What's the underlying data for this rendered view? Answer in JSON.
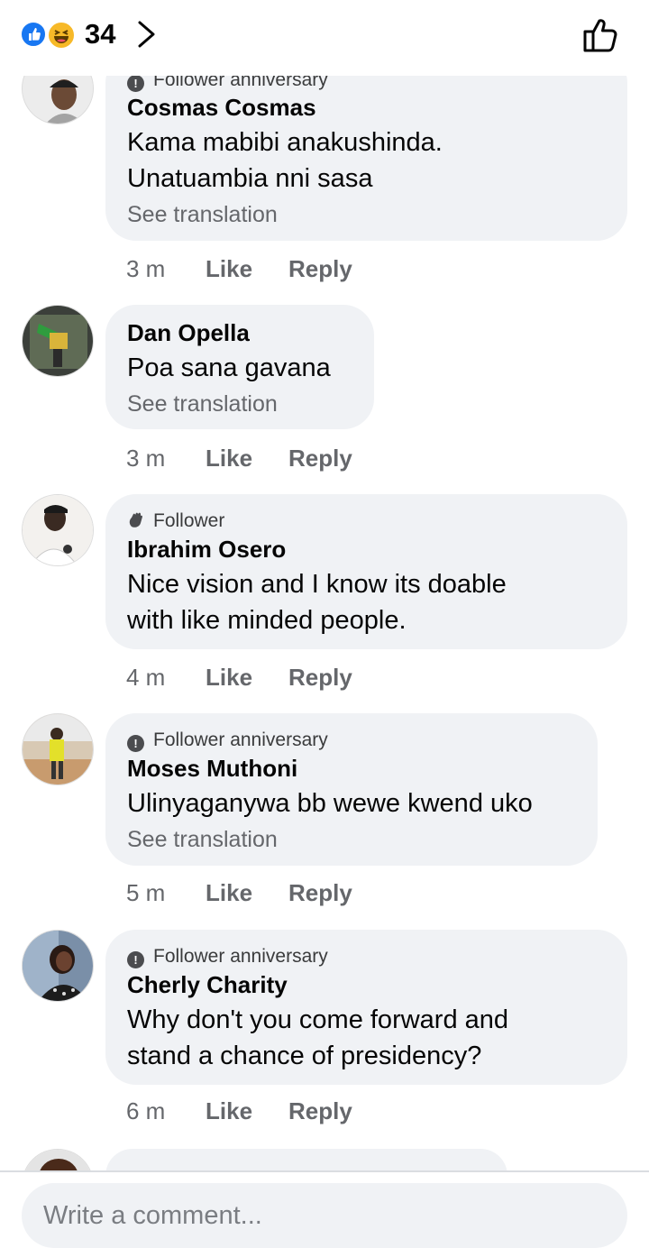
{
  "header": {
    "reaction_count": "34",
    "reaction_icons": [
      "like-reaction-icon",
      "haha-reaction-icon"
    ],
    "like_icon": "thumbs-up-outline-icon"
  },
  "comments": [
    {
      "badge": "Follower anniversary",
      "author": "Cosmas Cosmas",
      "text_lines": [
        "Kama mabibi anakushinda.",
        "Unatuambia nni sasa"
      ],
      "see_translation": "See translation",
      "time": "3 m",
      "like": "Like",
      "reply": "Reply"
    },
    {
      "badge": "",
      "author": "Dan Opella",
      "text_lines": [
        "Poa sana gavana"
      ],
      "see_translation": "See translation",
      "time": "3 m",
      "like": "Like",
      "reply": "Reply"
    },
    {
      "badge": "Follower",
      "author": "Ibrahim Osero",
      "text_lines": [
        "Nice vision and I know its doable",
        "with like minded people."
      ],
      "see_translation": "",
      "time": "4 m",
      "like": "Like",
      "reply": "Reply"
    },
    {
      "badge": "Follower anniversary",
      "author": "Moses Muthoni",
      "text_lines": [
        "Ulinyaganywa bb wewe kwend uko"
      ],
      "see_translation": "See translation",
      "time": "5 m",
      "like": "Like",
      "reply": "Reply"
    },
    {
      "badge": "Follower anniversary",
      "author": "Cherly Charity",
      "text_lines": [
        "Why don't you come forward and",
        "stand a chance of presidency?"
      ],
      "see_translation": "",
      "time": "6 m",
      "like": "Like",
      "reply": "Reply"
    }
  ],
  "composer": {
    "placeholder": "Write a comment..."
  },
  "colors": {
    "bubble": "#f0f2f5",
    "meta_text": "#65676b",
    "like_blue": "#1877f2",
    "haha_yellow": "#f7b928"
  }
}
